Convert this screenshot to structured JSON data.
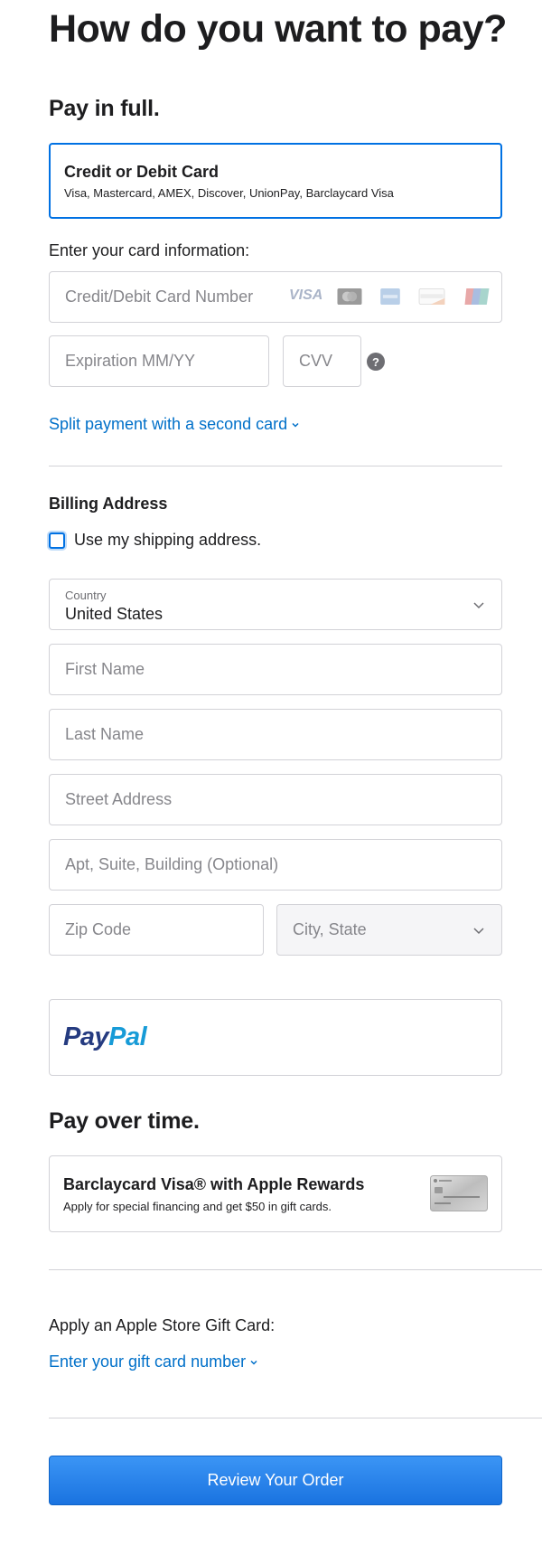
{
  "title": "How do you want to pay?",
  "pay_in_full": {
    "heading": "Pay in full.",
    "card_option": {
      "title": "Credit or Debit Card",
      "subtitle": "Visa, Mastercard, AMEX, Discover, UnionPay, Barclaycard Visa"
    },
    "card_info_label": "Enter your card information:",
    "card_number": {
      "placeholder": "Credit/Debit Card Number"
    },
    "card_brands": [
      "VISA",
      "Mastercard",
      "AMEX",
      "DISCOVER",
      "UnionPay"
    ],
    "expiration": {
      "placeholder": "Expiration MM/YY"
    },
    "cvv": {
      "placeholder": "CVV",
      "help": "?"
    },
    "split_link": "Split payment with a second card"
  },
  "billing": {
    "heading": "Billing Address",
    "use_shipping_label": "Use my shipping address.",
    "country": {
      "label": "Country",
      "value": "United States"
    },
    "first_name": {
      "placeholder": "First Name"
    },
    "last_name": {
      "placeholder": "Last Name"
    },
    "street": {
      "placeholder": "Street Address"
    },
    "apt": {
      "placeholder": "Apt, Suite, Building (Optional)"
    },
    "zip": {
      "placeholder": "Zip Code"
    },
    "city_state": {
      "placeholder": "City, State"
    }
  },
  "paypal": {
    "pay": "Pay",
    "pal": "Pal"
  },
  "pay_over_time": {
    "heading": "Pay over time.",
    "barclaycard": {
      "title": "Barclaycard Visa® with Apple Rewards",
      "subtitle": "Apply for special financing and get $50 in gift cards."
    }
  },
  "gift_card": {
    "label": "Apply an Apple Store Gift Card:",
    "link": "Enter your gift card number"
  },
  "review_button": "Review Your Order",
  "colors": {
    "accent": "#0071e3",
    "link": "#0070c9",
    "paypal_dark": "#253b80",
    "paypal_light": "#179bd7"
  }
}
